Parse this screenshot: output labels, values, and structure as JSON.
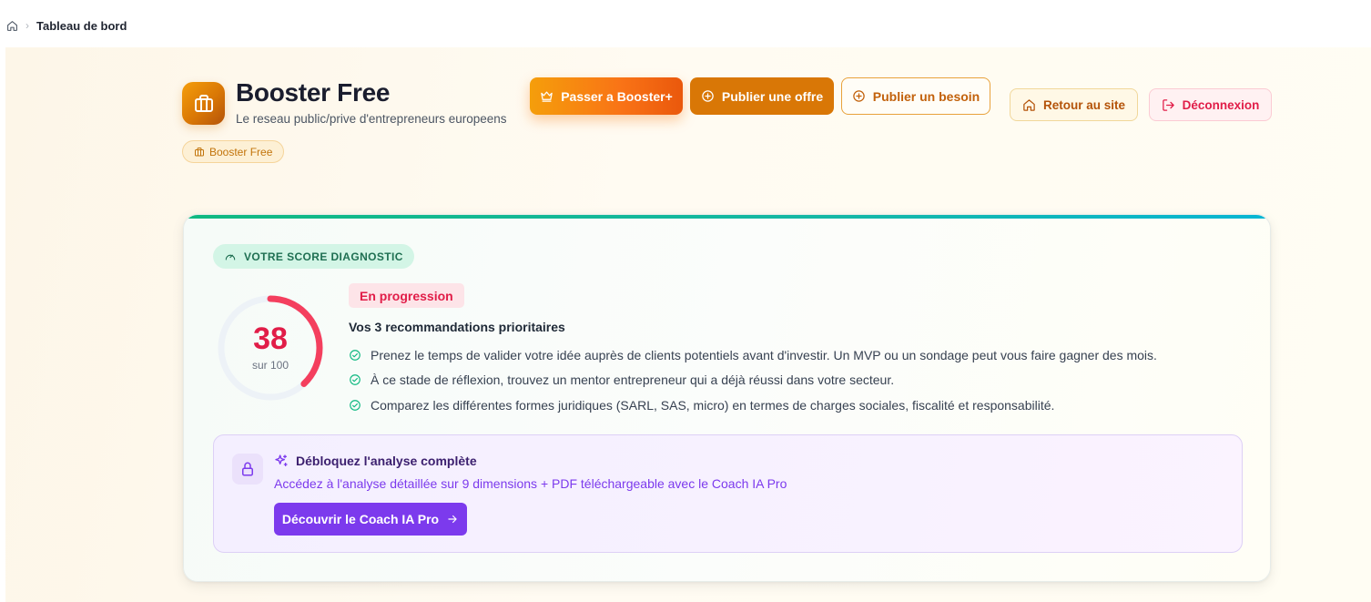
{
  "breadcrumb": {
    "home_icon": "home-icon",
    "current": "Tableau de bord"
  },
  "header": {
    "title": "Booster Free",
    "subtitle": "Le reseau public/prive d'entrepreneurs europeens",
    "plan_badge": "Booster Free",
    "logo_icon": "briefcase-icon",
    "accent_color": "#d97706"
  },
  "actions": {
    "upgrade_label": "Passer a Booster+",
    "publish_offer_label": "Publier une offre",
    "publish_need_label": "Publier un besoin",
    "back_to_site_label": "Retour au site",
    "logout_label": "Déconnexion"
  },
  "diagnostic": {
    "section_label": "VOTRE SCORE DIAGNOSTIC",
    "score": 38,
    "score_max_label": "sur 100",
    "score_fraction": 0.38,
    "score_color": "#f43f5e",
    "status": "En progression",
    "recommendations_title": "Vos 3 recommandations prioritaires",
    "recommendations": [
      "Prenez le temps de valider votre idée auprès de clients potentiels avant d'investir. Un MVP ou un sondage peut vous faire gagner des mois.",
      "À ce stade de réflexion, trouvez un mentor entrepreneur qui a déjà réussi dans votre secteur.",
      "Comparez les différentes formes juridiques (SARL, SAS, micro) en termes de charges sociales, fiscalité et responsabilité."
    ]
  },
  "upsell": {
    "title": "Débloquez l'analyse complète",
    "description": "Accédez à l'analyse détaillée sur 9 dimensions + PDF téléchargeable avec le Coach IA Pro",
    "cta_label": "Découvrir le Coach IA Pro",
    "accent_color": "#7c3aed"
  }
}
